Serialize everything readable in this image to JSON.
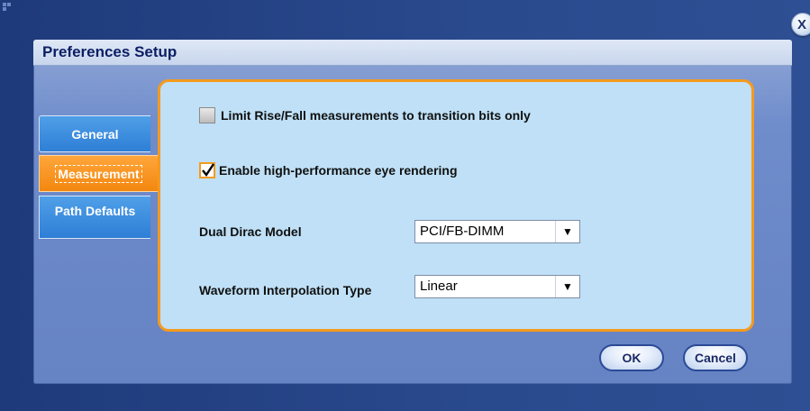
{
  "dialog": {
    "title": "Preferences Setup",
    "close_label": "X"
  },
  "tabs": [
    {
      "label": "General",
      "active": false
    },
    {
      "label": "Measurement",
      "active": true
    },
    {
      "label": "Path Defaults",
      "active": false
    }
  ],
  "measurement": {
    "limit_rise_fall": {
      "label": "Limit Rise/Fall measurements to transition bits only",
      "checked": false
    },
    "high_perf_eye": {
      "label": "Enable high-performance eye rendering",
      "checked": true
    },
    "dual_dirac_model": {
      "label": "Dual Dirac Model",
      "value": "PCI/FB-DIMM"
    },
    "waveform_interpolation": {
      "label": "Waveform Interpolation Type",
      "value": "Linear"
    }
  },
  "buttons": {
    "ok": "OK",
    "cancel": "Cancel"
  },
  "colors": {
    "accent_orange": "#f59a1e",
    "tab_blue": "#2e7fd6",
    "panel_bg": "#bfe0f6",
    "title_text": "#0b1e63"
  }
}
